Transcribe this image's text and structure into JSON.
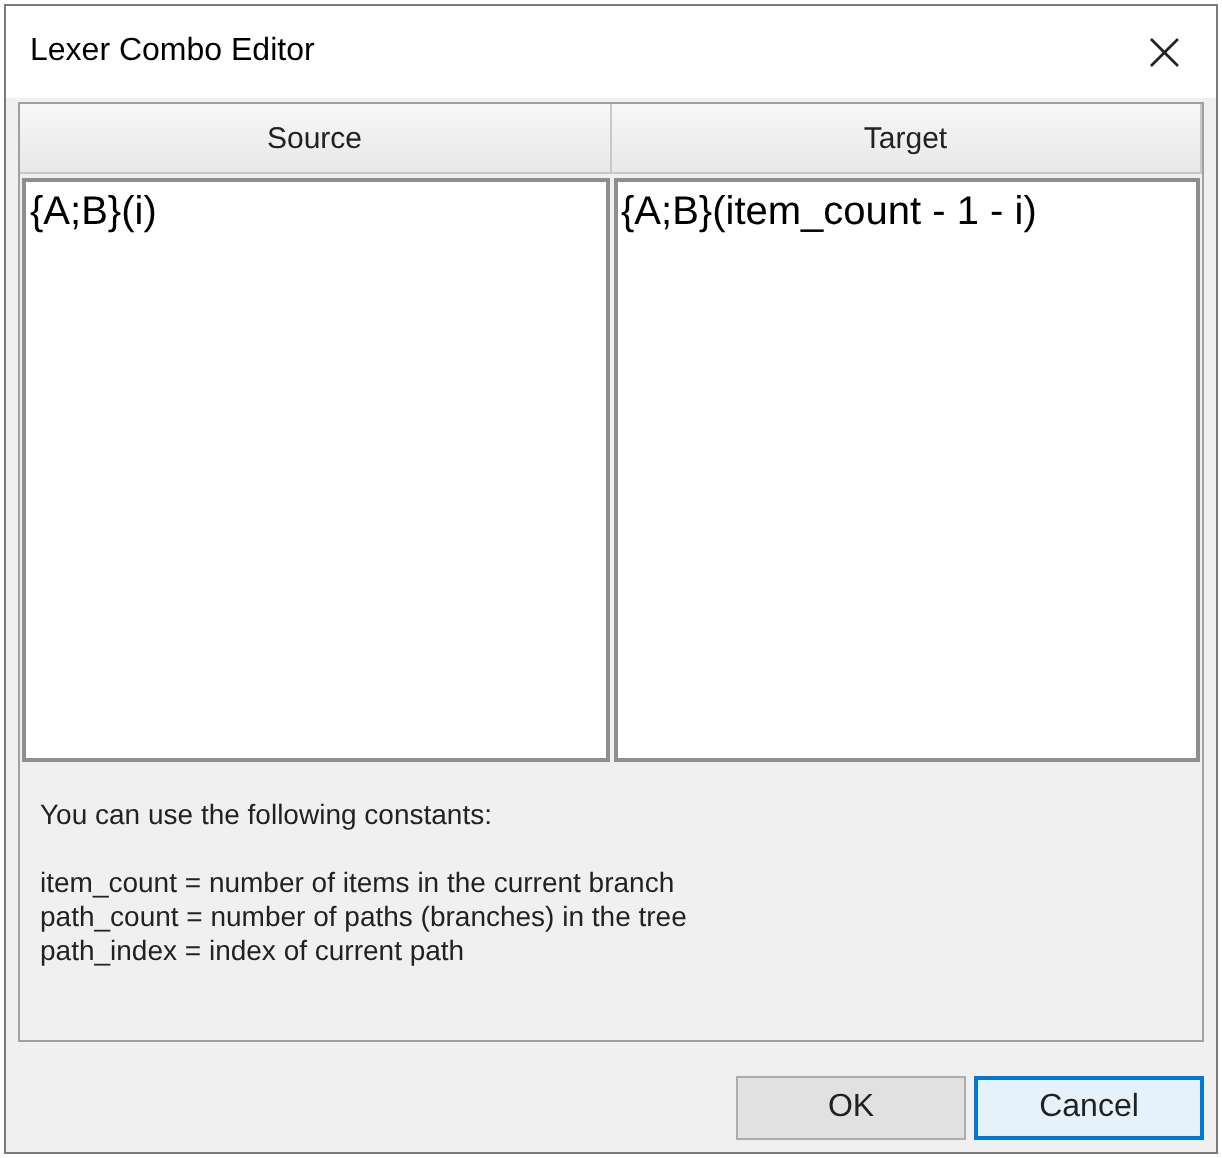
{
  "window": {
    "title": "Lexer Combo Editor",
    "close": "×"
  },
  "columns": [
    {
      "header": "Source",
      "value": "{A;B}(i)"
    },
    {
      "header": "Target",
      "value": "{A;B}(item_count - 1 - i)"
    }
  ],
  "info": {
    "intro": "You can use the following constants:",
    "constants": [
      "item_count = number of items in the current branch",
      "path_count = number of paths (branches) in the tree",
      "path_index = index of current path"
    ]
  },
  "buttons": [
    {
      "label": "OK",
      "focused": false
    },
    {
      "label": "Cancel",
      "focused": true
    }
  ]
}
